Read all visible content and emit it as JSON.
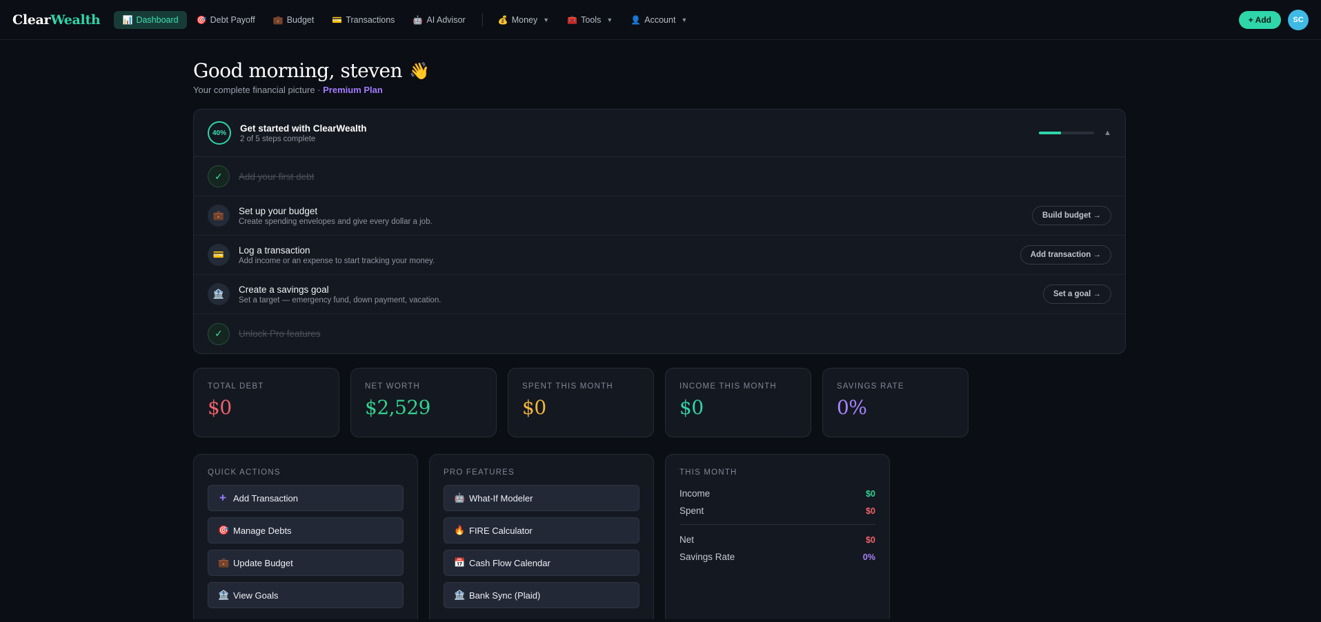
{
  "brand": {
    "part1": "Clear",
    "part2": "Wealth"
  },
  "nav": {
    "items": [
      {
        "label": "Dashboard",
        "icon": "📊",
        "active": true
      },
      {
        "label": "Debt Payoff",
        "icon": "🎯"
      },
      {
        "label": "Budget",
        "icon": "💼"
      },
      {
        "label": "Transactions",
        "icon": "💳"
      },
      {
        "label": "AI Advisor",
        "icon": "🤖"
      }
    ],
    "menus": [
      {
        "label": "Money",
        "icon": "💰"
      },
      {
        "label": "Tools",
        "icon": "🧰"
      },
      {
        "label": "Account",
        "icon": "👤"
      }
    ],
    "add_label": "+ Add",
    "avatar": "SC"
  },
  "header": {
    "greeting": "Good morning, steven",
    "wave": "👋",
    "subtitle": "Your complete financial picture ·",
    "plan": "Premium Plan"
  },
  "onboarding": {
    "percent": "40%",
    "progress": 0.4,
    "title": "Get started with ClearWealth",
    "steps_complete": "2 of 5 steps complete",
    "collapse": "▲",
    "steps": [
      {
        "title": "Add your first debt",
        "done": true,
        "icon": "✓"
      },
      {
        "title": "Set up your budget",
        "desc": "Create spending envelopes and give every dollar a job.",
        "icon": "💼",
        "button": "Build budget →"
      },
      {
        "title": "Log a transaction",
        "desc": "Add income or an expense to start tracking your money.",
        "icon": "💳",
        "button": "Add transaction →"
      },
      {
        "title": "Create a savings goal",
        "desc": "Set a target — emergency fund, down payment, vacation.",
        "icon": "🏦",
        "button": "Set a goal →"
      },
      {
        "title": "Unlock Pro features",
        "done": true,
        "icon": "✓"
      }
    ]
  },
  "stats": [
    {
      "label": "TOTAL DEBT",
      "value": "$0",
      "color": "#f0616a"
    },
    {
      "label": "NET WORTH",
      "value": "$2,529",
      "color": "#33d18f"
    },
    {
      "label": "SPENT THIS MONTH",
      "value": "$0",
      "color": "#f2b53c"
    },
    {
      "label": "INCOME THIS MONTH",
      "value": "$0",
      "color": "#33d1a6"
    },
    {
      "label": "SAVINGS RATE",
      "value": "0%",
      "color": "#a783ff"
    }
  ],
  "quick_actions": {
    "label": "QUICK ACTIONS",
    "items": [
      {
        "label": "Add Transaction",
        "icon": "+"
      },
      {
        "label": "Manage Debts",
        "icon": "🎯"
      },
      {
        "label": "Update Budget",
        "icon": "💼"
      },
      {
        "label": "View Goals",
        "icon": "🏦"
      }
    ]
  },
  "pro_features": {
    "label": "PRO FEATURES",
    "items": [
      {
        "label": "What-If Modeler",
        "icon": "🤖"
      },
      {
        "label": "FIRE Calculator",
        "icon": "🔥"
      },
      {
        "label": "Cash Flow Calendar",
        "icon": "📅"
      },
      {
        "label": "Bank Sync (Plaid)",
        "icon": "🏦"
      }
    ]
  },
  "this_month": {
    "label": "THIS MONTH",
    "income_label": "Income",
    "income": "$0",
    "spent_label": "Spent",
    "spent": "$0",
    "net_label": "Net",
    "net": "$0",
    "rate_label": "Savings Rate",
    "rate": "0%"
  }
}
